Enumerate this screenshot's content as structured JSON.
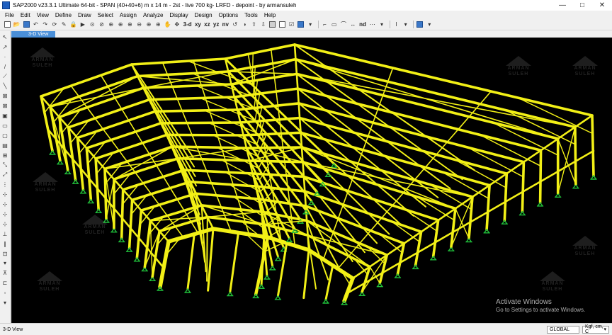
{
  "window": {
    "title": "SAP2000 v23.3.1 Ultimate 64-bit - SPAN (40+40+6) m  x 14 m - 2st - live 700 kg- LRFD - depoint - by armansuleh",
    "minimize": "—",
    "maximize": "□",
    "close": "✕"
  },
  "menu": [
    "File",
    "Edit",
    "View",
    "Define",
    "Draw",
    "Select",
    "Assign",
    "Analyze",
    "Display",
    "Design",
    "Options",
    "Tools",
    "Help"
  ],
  "toolbar": {
    "view_3d": "3-d",
    "view_xy": "xy",
    "view_xz": "xz",
    "view_yz": "yz",
    "view_nv": "nv",
    "snap_nd": "nd"
  },
  "tab": {
    "label": "3-D View"
  },
  "watermark": {
    "line1": "ARMAN",
    "line2": "SULEH"
  },
  "activation": {
    "title": "Activate Windows",
    "subtitle": "Go to Settings to activate Windows."
  },
  "status": {
    "view_name": "3-D View",
    "coord_system": "GLOBAL",
    "units": "Kgf, cm, C"
  },
  "colors": {
    "frame": "#f2f016",
    "support": "#1fbf3a",
    "background": "#000000",
    "tab": "#4a8fd8"
  }
}
